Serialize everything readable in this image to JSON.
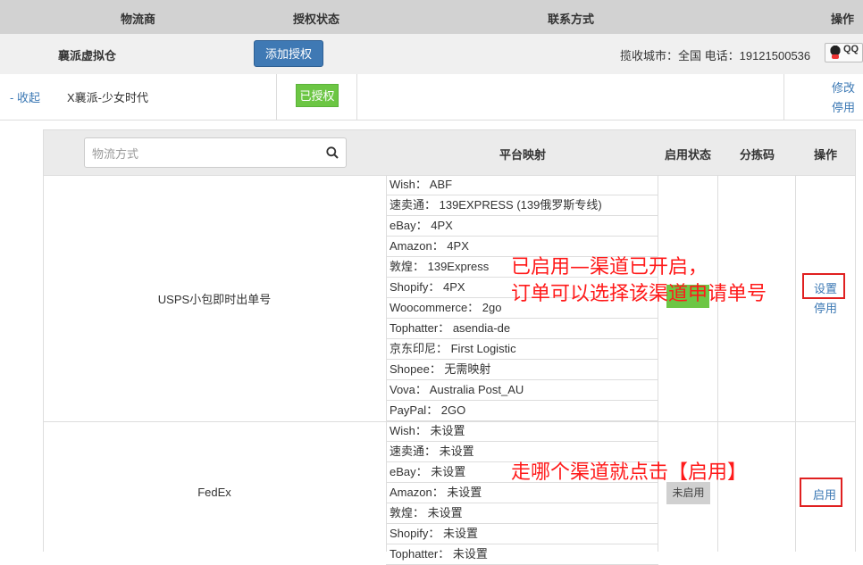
{
  "header": {
    "col_carrier": "物流商",
    "col_auth_status": "授权状态",
    "col_contact": "联系方式",
    "col_actions": "操作"
  },
  "carrier": {
    "name": "襄派虚拟仓",
    "add_auth_button": "添加授权",
    "contact_text": "揽收城市：全国   电话：19121500536",
    "qq_label": "QQ"
  },
  "account": {
    "collapse_link": "- 收起",
    "name": "X襄派-少女时代",
    "status_badge": "已授权",
    "edit_link": "修改",
    "disable_link": "停用"
  },
  "channels_table": {
    "search_placeholder": "物流方式",
    "col_platform_mapping": "平台映射",
    "col_enable_status": "启用状态",
    "col_sort_code": "分拣码",
    "col_actions": "操作",
    "rows": [
      {
        "name": "USPS小包即时出单号",
        "mappings": [
          "Wish：  ABF",
          "速卖通：  139EXPRESS (139俄罗斯专线)",
          "eBay：  4PX",
          "Amazon：  4PX",
          "敦煌：  139Express",
          "Shopify：  4PX",
          "Woocommerce：  2go",
          "Tophatter：  asendia-de",
          "京东印尼：  First Logistic",
          "Shopee：  无需映射",
          "Vova：  Australia Post_AU",
          "PayPal：  2GO"
        ],
        "status": "已启用",
        "status_color": "#6cc644",
        "action_settings": "设置",
        "action_disable": "停用"
      },
      {
        "name": "FedEx",
        "mappings": [
          "Wish：  未设置",
          "速卖通：  未设置",
          "eBay：  未设置",
          "Amazon：  未设置",
          "敦煌：  未设置",
          "Shopify：  未设置",
          "Tophatter：  未设置"
        ],
        "status": "未启用",
        "status_color": "#d0d0d0",
        "action_enable": "启用"
      }
    ]
  },
  "annotations": {
    "line1": "已启用—渠道已开启，",
    "line2": "订单可以选择该渠道申请单号",
    "line3": "走哪个渠道就点击【启用】",
    "color": "#ff1a1a"
  }
}
